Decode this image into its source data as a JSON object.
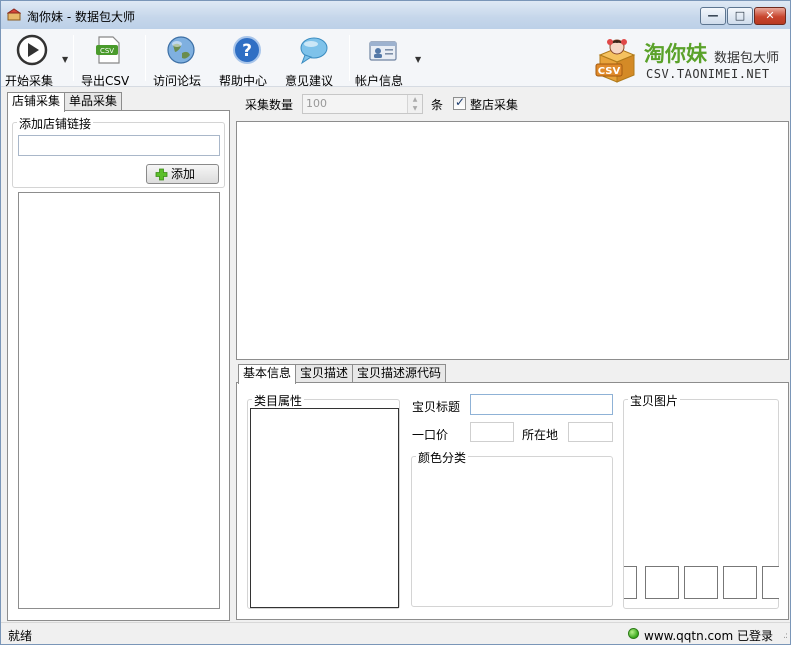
{
  "window": {
    "title": "淘你妹 - 数据包大师"
  },
  "toolbar": {
    "start": "开始采集",
    "export": "导出CSV",
    "forum": "访问论坛",
    "help": "帮助中心",
    "feedback": "意见建议",
    "account": "帐户信息",
    "csv_icon_text": "CSV"
  },
  "brand": {
    "name": "淘你妹",
    "subtitle": "数据包大师",
    "url": "CSV.TAONIMEI.NET",
    "badge": "CSV"
  },
  "left": {
    "tabs": [
      "店铺采集",
      "单品采集"
    ],
    "group_label": "添加店铺链接",
    "add_button": "添加"
  },
  "collect": {
    "count_label": "采集数量",
    "count_value": "100",
    "unit": "条",
    "whole_shop_label": "整店采集",
    "whole_shop_checked": true
  },
  "detail": {
    "tabs": [
      "基本信息",
      "宝贝描述",
      "宝贝描述源代码"
    ],
    "category_label": "类目属性",
    "title_label": "宝贝标题",
    "price_label": "一口价",
    "location_label": "所在地",
    "color_label": "颜色分类",
    "images_label": "宝贝图片"
  },
  "status": {
    "ready": "就绪",
    "site": "www.qqtn.com",
    "login": "已登录"
  }
}
